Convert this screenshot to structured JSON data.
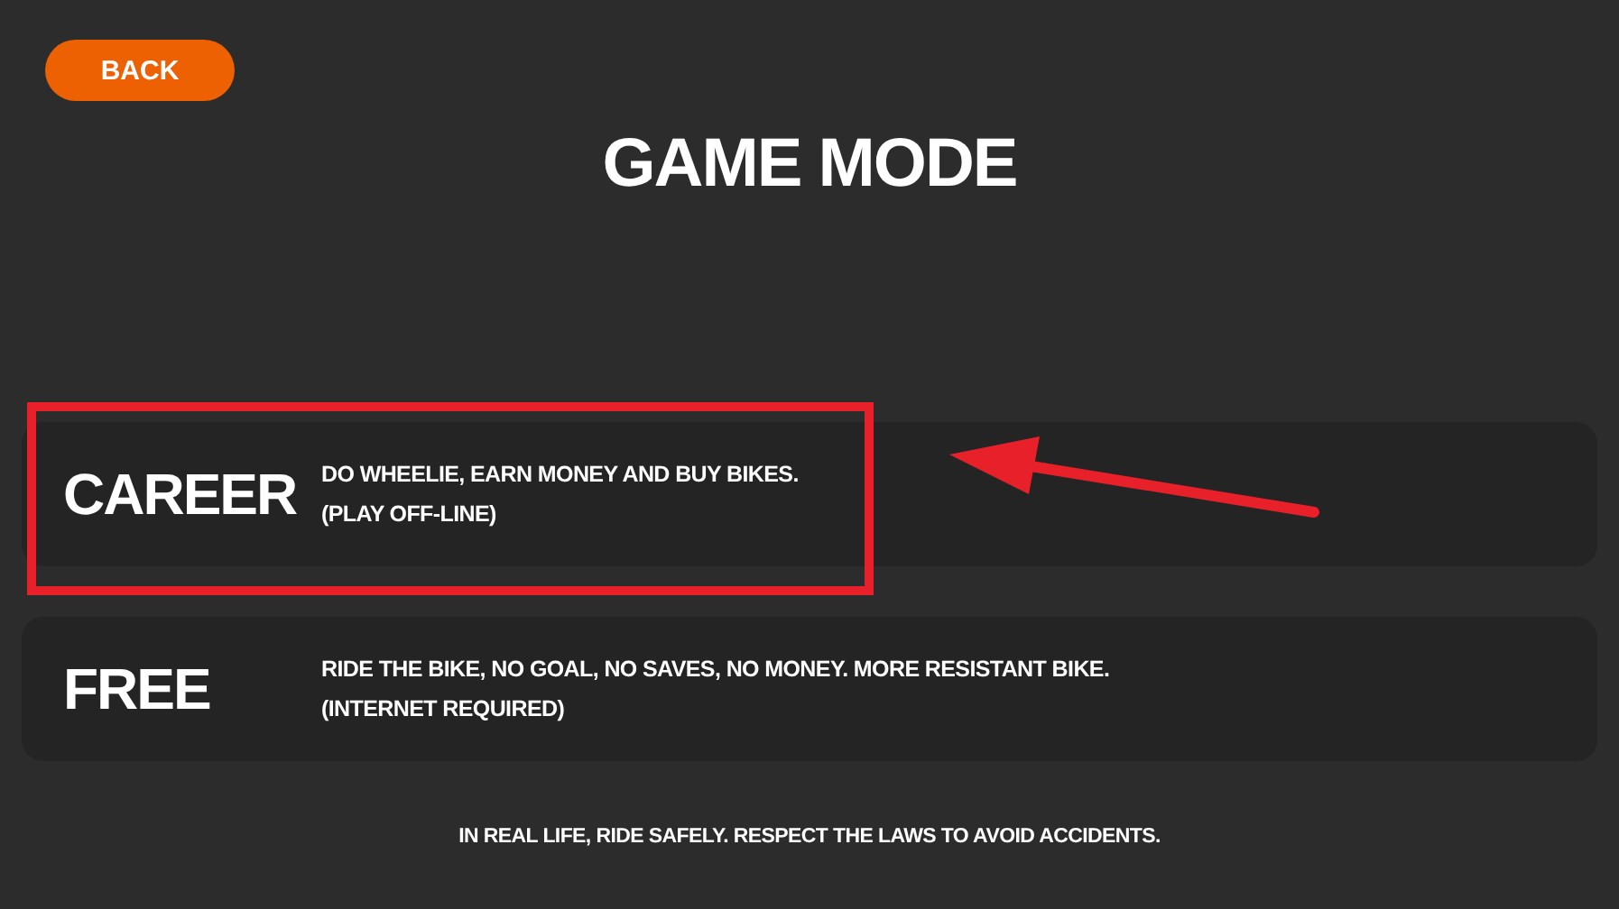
{
  "back_button": "BACK",
  "title": "GAME MODE",
  "modes": [
    {
      "name": "CAREER",
      "description": "DO WHEELIE, EARN MONEY AND BUY BIKES.",
      "note": "(PLAY OFF-LINE)",
      "highlighted": true
    },
    {
      "name": "FREE",
      "description": "RIDE THE BIKE, NO GOAL, NO SAVES, NO MONEY. MORE RESISTANT BIKE.",
      "note": "(INTERNET REQUIRED)",
      "highlighted": false
    }
  ],
  "footer": "IN REAL LIFE, RIDE SAFELY. RESPECT THE LAWS TO AVOID ACCIDENTS."
}
